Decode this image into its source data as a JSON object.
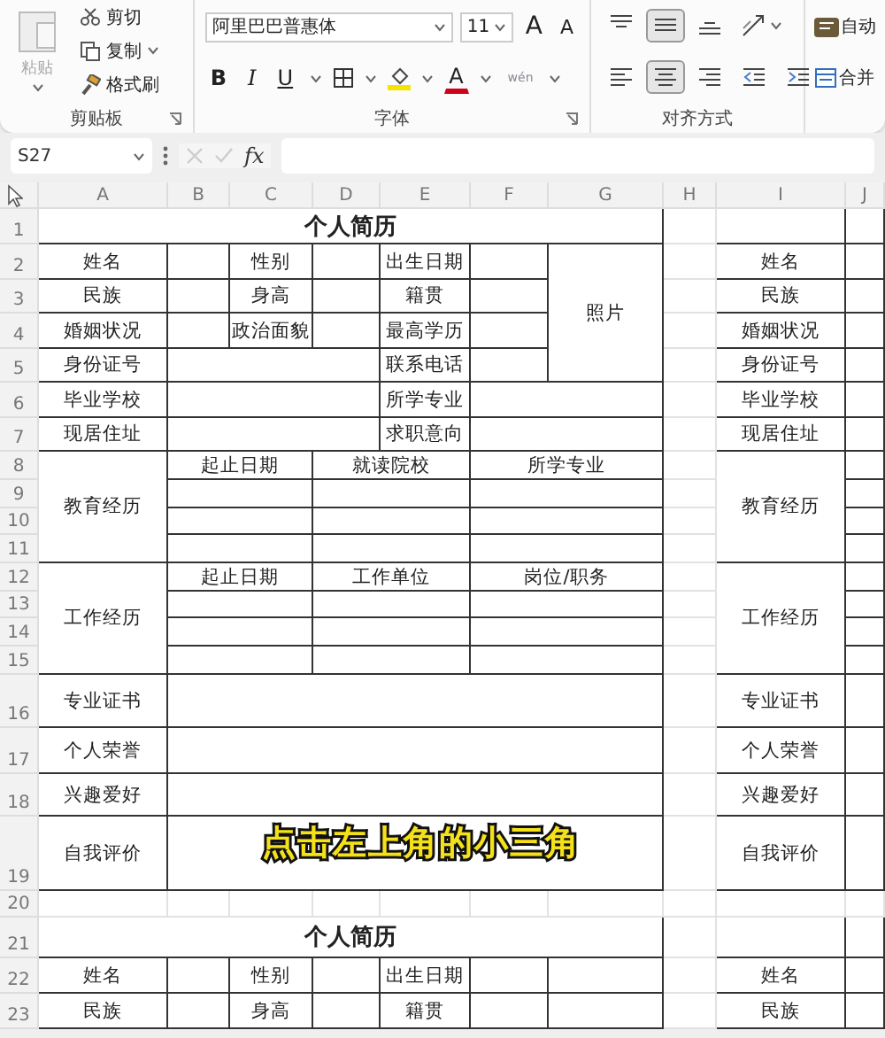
{
  "ribbon": {
    "clipboard": {
      "label": "剪贴板",
      "paste": "粘贴",
      "cut": "剪切",
      "copy": "复制",
      "format_painter": "格式刷"
    },
    "font": {
      "label": "字体",
      "font_name": "阿里巴巴普惠体",
      "font_size": "11",
      "grow": "A",
      "shrink": "A",
      "bold": "B",
      "italic": "I",
      "underline": "U",
      "font_color": "A",
      "phonetic": "wén"
    },
    "alignment": {
      "label": "对齐方式",
      "buttons": [
        {
          "kind": "align-top",
          "selected": false
        },
        {
          "kind": "align-middle",
          "selected": true
        },
        {
          "kind": "align-bottom",
          "selected": false
        },
        {
          "kind": "orientation",
          "selected": false
        },
        {
          "kind": "align-left",
          "selected": false
        },
        {
          "kind": "align-center",
          "selected": true
        },
        {
          "kind": "align-right",
          "selected": false
        },
        {
          "kind": "indent-decrease",
          "selected": false
        },
        {
          "kind": "indent-increase",
          "selected": false
        }
      ],
      "wrap": "自动",
      "merge": "合并"
    }
  },
  "formula_bar": {
    "name_box": "S27",
    "function_label": "fx"
  },
  "sheet": {
    "columns": [
      "A",
      "B",
      "C",
      "D",
      "E",
      "F",
      "G",
      "H",
      "I",
      "J"
    ],
    "rows": [
      "1",
      "2",
      "3",
      "4",
      "5",
      "6",
      "7",
      "8",
      "9",
      "10",
      "11",
      "12",
      "13",
      "14",
      "15",
      "16",
      "17",
      "18",
      "19",
      "20",
      "21",
      "22",
      "23"
    ],
    "cells": [
      {
        "kind": "title",
        "text": "个人简历"
      },
      {
        "kind": "label",
        "text": "姓名"
      },
      {
        "kind": "label",
        "text": "性别"
      },
      {
        "kind": "label",
        "text": "出生日期"
      },
      {
        "kind": "label",
        "text": "照片"
      },
      {
        "kind": "label",
        "text": "民族"
      },
      {
        "kind": "label",
        "text": "身高"
      },
      {
        "kind": "label",
        "text": "籍贯"
      },
      {
        "kind": "label",
        "text": "婚姻状况"
      },
      {
        "kind": "label",
        "text": "政治面貌"
      },
      {
        "kind": "label",
        "text": "最高学历"
      },
      {
        "kind": "label",
        "text": "身份证号"
      },
      {
        "kind": "label",
        "text": "联系电话"
      },
      {
        "kind": "label",
        "text": "毕业学校"
      },
      {
        "kind": "label",
        "text": "所学专业"
      },
      {
        "kind": "label",
        "text": "现居住址"
      },
      {
        "kind": "label",
        "text": "求职意向"
      },
      {
        "kind": "label",
        "text": "教育经历"
      },
      {
        "kind": "label",
        "text": "起止日期"
      },
      {
        "kind": "label",
        "text": "就读院校"
      },
      {
        "kind": "label",
        "text": "所学专业"
      },
      {
        "kind": "label",
        "text": "工作经历"
      },
      {
        "kind": "label",
        "text": "起止日期"
      },
      {
        "kind": "label",
        "text": "工作单位"
      },
      {
        "kind": "label",
        "text": "岗位/职务"
      },
      {
        "kind": "label",
        "text": "专业证书"
      },
      {
        "kind": "label",
        "text": "个人荣誉"
      },
      {
        "kind": "label",
        "text": "兴趣爱好"
      },
      {
        "kind": "label",
        "text": "自我评价"
      },
      {
        "kind": "title",
        "text": "个人简历"
      },
      {
        "kind": "label",
        "text": "姓名"
      },
      {
        "kind": "label",
        "text": "性别"
      },
      {
        "kind": "label",
        "text": "出生日期"
      },
      {
        "kind": "label",
        "text": "民族"
      },
      {
        "kind": "label",
        "text": "身高"
      },
      {
        "kind": "label",
        "text": "籍贯"
      },
      {
        "kind": "label",
        "text": "姓名"
      },
      {
        "kind": "label",
        "text": "民族"
      },
      {
        "kind": "label",
        "text": "婚姻状况"
      },
      {
        "kind": "label",
        "text": "身份证号"
      },
      {
        "kind": "label",
        "text": "毕业学校"
      },
      {
        "kind": "label",
        "text": "现居住址"
      },
      {
        "kind": "label",
        "text": "教育经历"
      },
      {
        "kind": "label",
        "text": "工作经历"
      },
      {
        "kind": "label",
        "text": "专业证书"
      },
      {
        "kind": "label",
        "text": "个人荣誉"
      },
      {
        "kind": "label",
        "text": "兴趣爱好"
      },
      {
        "kind": "label",
        "text": "自我评价"
      },
      {
        "kind": "label",
        "text": "姓名"
      },
      {
        "kind": "label",
        "text": "民族"
      }
    ],
    "caption": "点击左上角的小三角"
  }
}
